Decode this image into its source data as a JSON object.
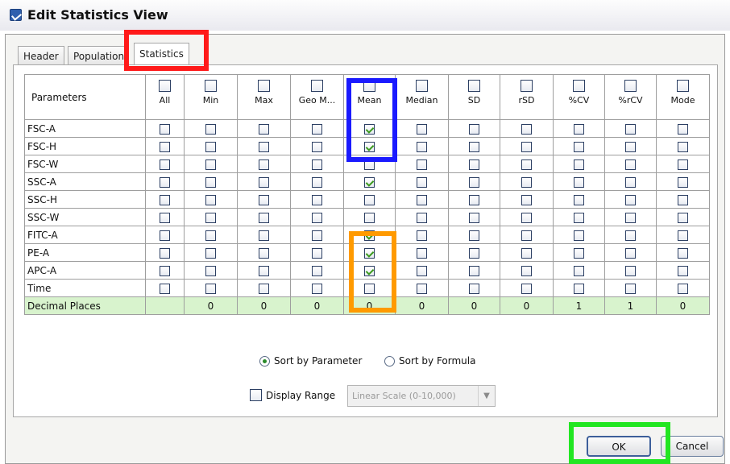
{
  "window": {
    "title": "Edit Statistics View"
  },
  "tabs": [
    {
      "label": "Header"
    },
    {
      "label": "Population"
    },
    {
      "label": "Statistics"
    }
  ],
  "grid": {
    "parameters_header": "Parameters",
    "columns": [
      "All",
      "Min",
      "Max",
      "Geo M...",
      "Mean",
      "Median",
      "SD",
      "rSD",
      "%CV",
      "%rCV",
      "Mode"
    ],
    "rows": [
      {
        "name": "FSC-A",
        "checked": [
          false,
          false,
          false,
          false,
          true,
          false,
          false,
          false,
          false,
          false,
          false
        ]
      },
      {
        "name": "FSC-H",
        "checked": [
          false,
          false,
          false,
          false,
          true,
          false,
          false,
          false,
          false,
          false,
          false
        ]
      },
      {
        "name": "FSC-W",
        "checked": [
          false,
          false,
          false,
          false,
          false,
          false,
          false,
          false,
          false,
          false,
          false
        ]
      },
      {
        "name": "SSC-A",
        "checked": [
          false,
          false,
          false,
          false,
          true,
          false,
          false,
          false,
          false,
          false,
          false
        ]
      },
      {
        "name": "SSC-H",
        "checked": [
          false,
          false,
          false,
          false,
          false,
          false,
          false,
          false,
          false,
          false,
          false
        ]
      },
      {
        "name": "SSC-W",
        "checked": [
          false,
          false,
          false,
          false,
          false,
          false,
          false,
          false,
          false,
          false,
          false
        ]
      },
      {
        "name": "FITC-A",
        "checked": [
          false,
          false,
          false,
          false,
          true,
          false,
          false,
          false,
          false,
          false,
          false
        ]
      },
      {
        "name": "PE-A",
        "checked": [
          false,
          false,
          false,
          false,
          true,
          false,
          false,
          false,
          false,
          false,
          false
        ]
      },
      {
        "name": "APC-A",
        "checked": [
          false,
          false,
          false,
          false,
          true,
          false,
          false,
          false,
          false,
          false,
          false
        ]
      },
      {
        "name": "Time",
        "checked": [
          false,
          false,
          false,
          false,
          false,
          false,
          false,
          false,
          false,
          false,
          false
        ]
      }
    ],
    "decimal": {
      "label": "Decimal Places",
      "values": [
        "",
        "0",
        "0",
        "0",
        "0",
        "0",
        "0",
        "0",
        "1",
        "1",
        "0"
      ]
    }
  },
  "sort": {
    "by_parameter": "Sort by Parameter",
    "by_formula": "Sort by Formula",
    "selected": "by_parameter"
  },
  "display_range": {
    "label": "Display Range",
    "checked": false,
    "select_value": "Linear Scale (0-10,000)"
  },
  "buttons": {
    "ok": "OK",
    "cancel": "Cancel"
  },
  "annotation_colors": {
    "statistics_tab": "#ff1a1a",
    "mean_header": "#1a1aff",
    "mean_selected": "#ff9a00",
    "ok_button": "#22e622"
  }
}
